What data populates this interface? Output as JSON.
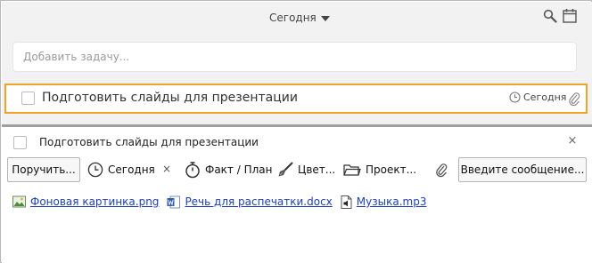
{
  "header": {
    "date_selector": "Сегодня"
  },
  "add_task": {
    "placeholder": "Добавить задачу..."
  },
  "task": {
    "title": "Подготовить слайды для презентации",
    "due": "Сегодня"
  },
  "details": {
    "title": "Подготовить слайды для презентации",
    "close_symbol": "×",
    "toolbar": {
      "assign_label": "Поручить...",
      "due_label": "Сегодня",
      "clear_symbol": "×",
      "time_label": "Факт / План",
      "color_label": "Цвет...",
      "project_label": "Проект...",
      "message_label": "Введите сообщение..."
    },
    "attachments": [
      {
        "name": "Фоновая картинка.png",
        "icon": "image-file-icon"
      },
      {
        "name": "Речь для распечатки.docx",
        "icon": "word-file-icon"
      },
      {
        "name": "Музыка.mp3",
        "icon": "audio-file-icon"
      }
    ]
  },
  "colors": {
    "accent_border": "#f0a32a",
    "link": "#1f3fb0",
    "panel_bg": "#f2f2f2"
  }
}
